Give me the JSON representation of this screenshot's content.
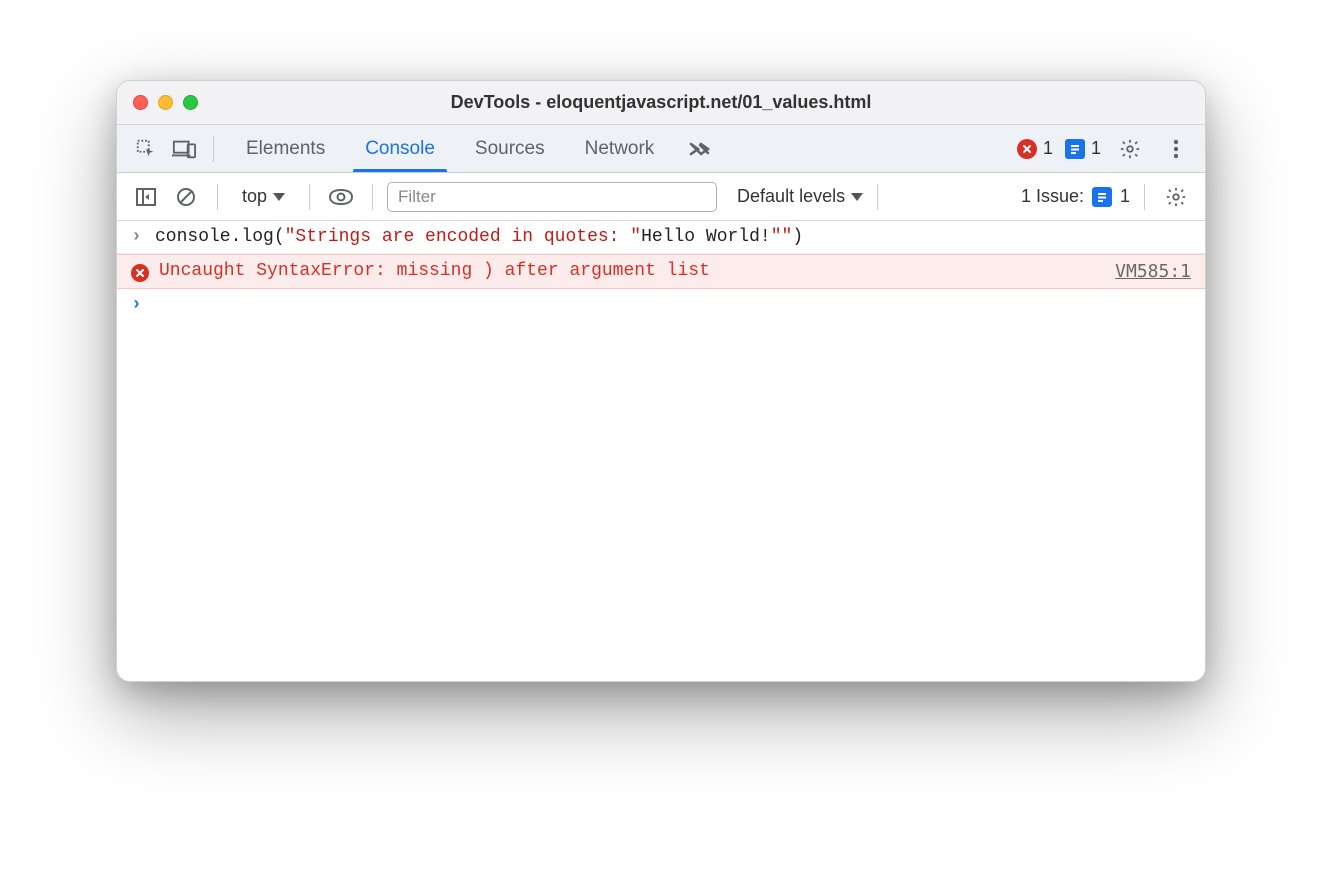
{
  "window": {
    "title": "DevTools - eloquentjavascript.net/01_values.html"
  },
  "tabs": {
    "items": [
      "Elements",
      "Console",
      "Sources",
      "Network"
    ],
    "active_index": 1
  },
  "tabbar_right": {
    "error_count": "1",
    "issue_count": "1"
  },
  "filterbar": {
    "context": "top",
    "filter_placeholder": "Filter",
    "levels_label": "Default levels",
    "issues_label": "1 Issue:",
    "issues_count": "1"
  },
  "console": {
    "input_line": {
      "pre": "console.log(",
      "str1": "\"Strings are encoded in quotes: \"",
      "mid": "Hello World!",
      "str2": "\"\"",
      "post": ")"
    },
    "error_line": {
      "message": "Uncaught SyntaxError: missing ) after argument list",
      "source": "VM585:1"
    }
  }
}
